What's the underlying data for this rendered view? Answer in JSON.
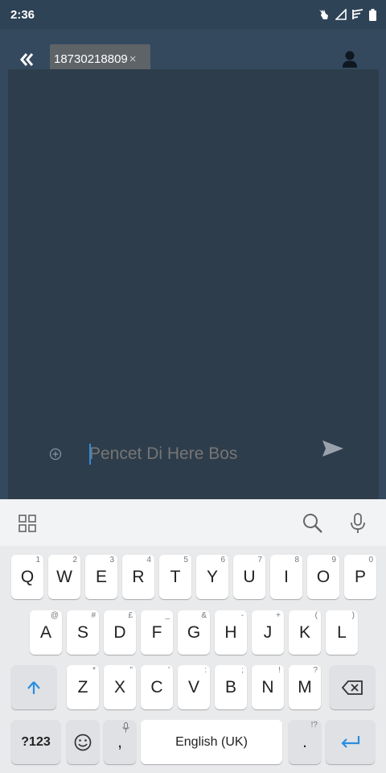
{
  "status_bar": {
    "time": "2:36"
  },
  "header": {
    "recipient_chip": "18730218809",
    "chip_close": "×"
  },
  "composer": {
    "placeholder": "Pencet Di Here Bos"
  },
  "keyboard": {
    "rows": [
      [
        {
          "label": "Q",
          "hint": "1"
        },
        {
          "label": "W",
          "hint": "2"
        },
        {
          "label": "E",
          "hint": "3"
        },
        {
          "label": "R",
          "hint": "4"
        },
        {
          "label": "T",
          "hint": "5"
        },
        {
          "label": "Y",
          "hint": "6"
        },
        {
          "label": "U",
          "hint": "7"
        },
        {
          "label": "I",
          "hint": "8"
        },
        {
          "label": "O",
          "hint": "9"
        },
        {
          "label": "P",
          "hint": "0"
        }
      ],
      [
        {
          "label": "A",
          "hint": "@"
        },
        {
          "label": "S",
          "hint": "#"
        },
        {
          "label": "D",
          "hint": "£"
        },
        {
          "label": "F",
          "hint": "_"
        },
        {
          "label": "G",
          "hint": "&"
        },
        {
          "label": "H",
          "hint": "-"
        },
        {
          "label": "J",
          "hint": "+"
        },
        {
          "label": "K",
          "hint": "("
        },
        {
          "label": "L",
          "hint": ")"
        }
      ],
      [
        {
          "label": "Z",
          "hint": "*"
        },
        {
          "label": "X",
          "hint": "\""
        },
        {
          "label": "C",
          "hint": "'"
        },
        {
          "label": "V",
          "hint": ":"
        },
        {
          "label": "B",
          "hint": ";"
        },
        {
          "label": "N",
          "hint": "!"
        },
        {
          "label": "M",
          "hint": "?"
        }
      ]
    ],
    "symbols_key": "?123",
    "comma_key": ",",
    "space_key": "English (UK)",
    "period_key": ".",
    "period_hint": "!?"
  }
}
